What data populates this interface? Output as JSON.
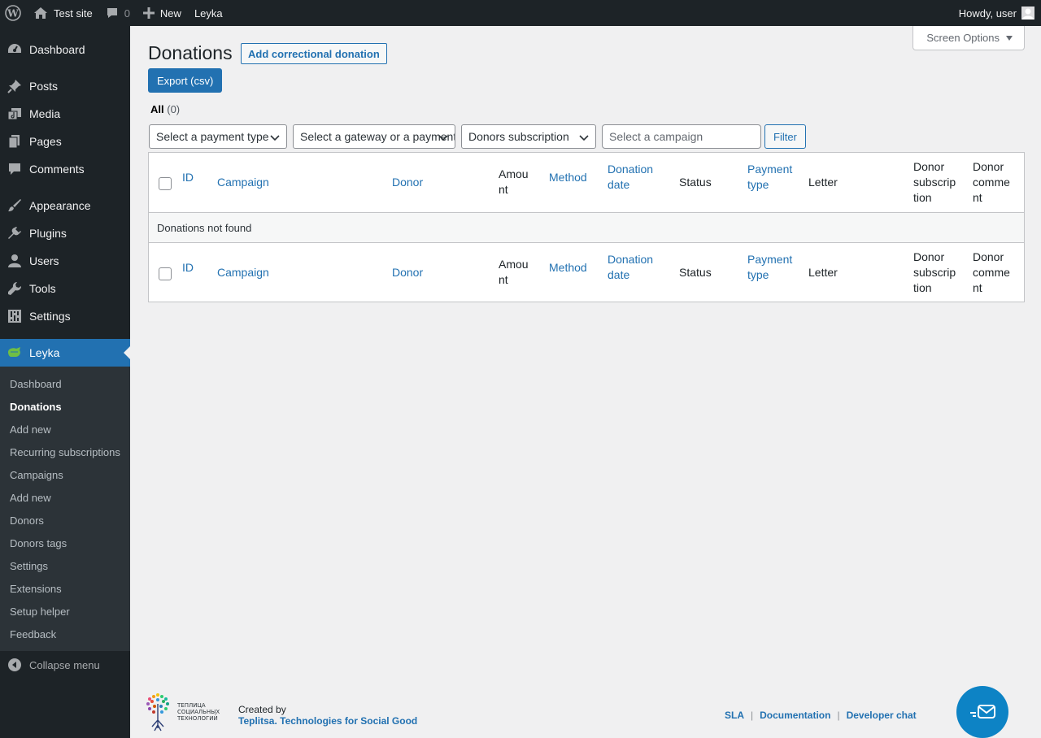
{
  "adminbar": {
    "site_name": "Test site",
    "comments_count": "0",
    "new_label": "New",
    "plugin_label": "Leyka",
    "greeting": "Howdy, user"
  },
  "sidebar": {
    "items": [
      {
        "label": "Dashboard",
        "icon": "dashboard-icon"
      },
      {
        "label": "Posts",
        "icon": "pin-icon"
      },
      {
        "label": "Media",
        "icon": "media-icon"
      },
      {
        "label": "Pages",
        "icon": "pages-icon"
      },
      {
        "label": "Comments",
        "icon": "comment-icon"
      },
      {
        "label": "Appearance",
        "icon": "brush-icon"
      },
      {
        "label": "Plugins",
        "icon": "plug-icon"
      },
      {
        "label": "Users",
        "icon": "user-icon"
      },
      {
        "label": "Tools",
        "icon": "wrench-icon"
      },
      {
        "label": "Settings",
        "icon": "settings-icon"
      },
      {
        "label": "Leyka",
        "icon": "leyka-icon"
      }
    ],
    "submenu": [
      "Dashboard",
      "Donations",
      "Add new",
      "Recurring subscriptions",
      "Campaigns",
      "Add new",
      "Donors",
      "Donors tags",
      "Settings",
      "Extensions",
      "Setup helper",
      "Feedback"
    ],
    "collapse_label": "Collapse menu"
  },
  "screen_options": "Screen Options",
  "page": {
    "title": "Donations",
    "add_correctional": "Add correctional donation",
    "export": "Export (csv)",
    "view_all": "All",
    "view_count": "(0)"
  },
  "filters": {
    "payment_type": "Select a payment type",
    "gateway": "Select a gateway or a payment method",
    "subscription": "Donors subscription",
    "campaign_placeholder": "Select a campaign",
    "filter_button": "Filter"
  },
  "table": {
    "columns": {
      "id": "ID",
      "campaign": "Campaign",
      "donor": "Donor",
      "amount_a": "Amou",
      "amount_b": "nt",
      "method": "Method",
      "date_a": "Donation",
      "date_b": "date",
      "status": "Status",
      "ptype_a": "Payment",
      "ptype_b": "type",
      "letter": "Letter",
      "sub_a": "Donor",
      "sub_b": "subscrip",
      "sub_c": "tion",
      "comment_a": "Donor",
      "comment_b": "comme",
      "comment_c": "nt"
    },
    "empty_message": "Donations not found"
  },
  "footer": {
    "created_by": "Created by",
    "org": "Teplitsa. Technologies for Social Good",
    "logo_text_1": "ТЕПЛИЦА",
    "logo_text_2": "СОЦИАЛЬНЫХ",
    "logo_text_3": "ТЕХНОЛОГИЙ",
    "links": [
      "SLA",
      "Documentation",
      "Developer chat"
    ]
  },
  "colors": {
    "accent": "#2271b1",
    "adminbar": "#1d2327",
    "chat": "#0d83c5"
  }
}
